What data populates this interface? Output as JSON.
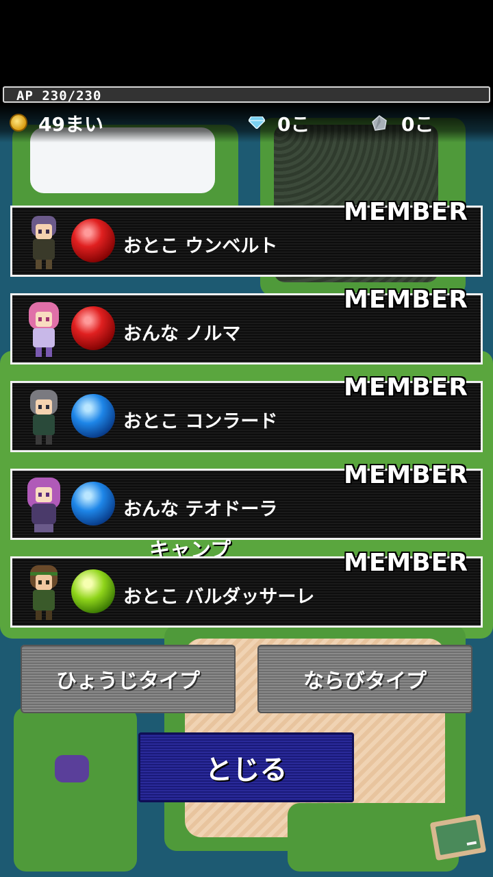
{
  "hud": {
    "ap_label": "AP 230/230",
    "coins": "49まい",
    "gems": "0こ",
    "stones": "0こ"
  },
  "map_label": "キャンプ",
  "members": [
    {
      "tag": "MEMBER",
      "name": "おとこ ウンベルト",
      "orb": "red",
      "hair": "#6b5a8a",
      "outfit": "#3a3a2a"
    },
    {
      "tag": "MEMBER",
      "name": "おんな ノルマ",
      "orb": "red",
      "hair": "#e070a8",
      "outfit": "#c8b8e8"
    },
    {
      "tag": "MEMBER",
      "name": "おとこ コンラード",
      "orb": "blue",
      "hair": "#7a7a80",
      "outfit": "#2a4a3a"
    },
    {
      "tag": "MEMBER",
      "name": "おんな テオドーラ",
      "orb": "blue",
      "hair": "#b05ab8",
      "outfit": "#4a3a6a"
    },
    {
      "tag": "MEMBER",
      "name": "おとこ バルダッサーレ",
      "orb": "green",
      "hair": "#6a4a2a",
      "outfit": "#3a5a2a"
    }
  ],
  "buttons": {
    "display_type": "ひょうじタイプ",
    "sort_type": "ならびタイプ",
    "close": "とじる"
  },
  "icons": {
    "coin": "coin-icon",
    "gem": "diamond-icon",
    "stone": "stone-icon",
    "board": "chalkboard-icon"
  }
}
